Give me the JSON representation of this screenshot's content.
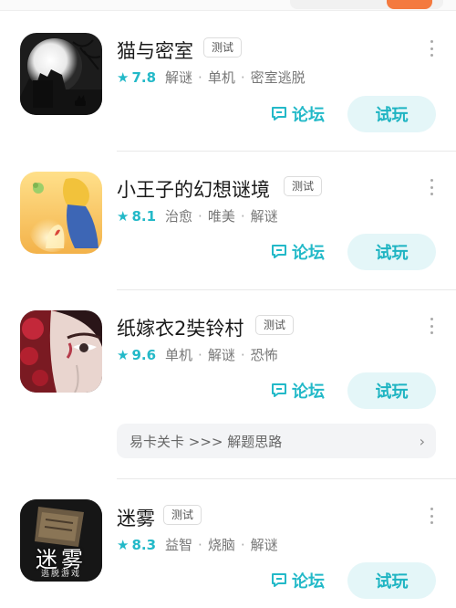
{
  "header": {
    "partial_text": "",
    "button_label": ""
  },
  "games": [
    {
      "title": "猫与密室",
      "badge": "测试",
      "rating": "7.8",
      "tags": [
        "解谜",
        "单机",
        "密室逃脱"
      ],
      "forum_label": "论坛",
      "play_label": "试玩"
    },
    {
      "title": "小王子的幻想谜境",
      "badge": "测试",
      "rating": "8.1",
      "tags": [
        "治愈",
        "唯美",
        "解谜"
      ],
      "forum_label": "论坛",
      "play_label": "试玩"
    },
    {
      "title": "纸嫁衣2奘铃村",
      "badge": "测试",
      "rating": "9.6",
      "tags": [
        "单机",
        "解谜",
        "恐怖"
      ],
      "forum_label": "论坛",
      "play_label": "试玩",
      "tip": "易卡关卡 >>> 解题思路"
    },
    {
      "title": "迷雾",
      "badge": "测试",
      "rating": "8.3",
      "tags": [
        "益智",
        "烧脑",
        "解谜"
      ],
      "forum_label": "论坛",
      "play_label": "试玩",
      "icon_text": "迷雾",
      "icon_subtext": "逃脱游戏"
    }
  ],
  "colors": {
    "accent": "#23b9c8",
    "play_bg": "#e4f6f8",
    "orange": "#f47a3f"
  },
  "icons": {
    "rating": "star-icon",
    "forum": "chat-bubble-icon",
    "more": "more-vertical-icon",
    "tip": "chevron-right-icon"
  }
}
